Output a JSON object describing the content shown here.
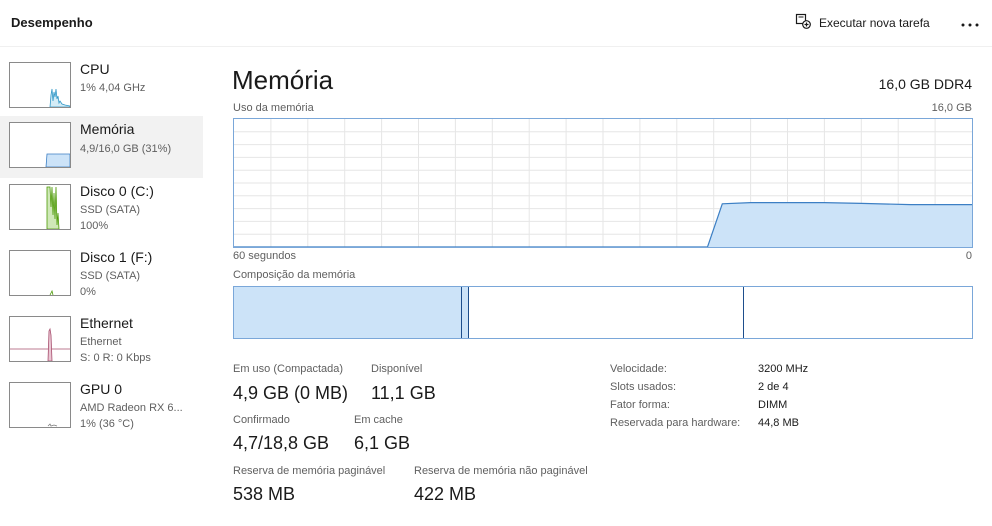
{
  "header": {
    "title": "Desempenho",
    "run_task_label": "Executar nova tarefa",
    "run_task_icon": "new-task-icon",
    "more_icon": "more-options-icon"
  },
  "sidebar": {
    "items": [
      {
        "name": "CPU",
        "line1": "1%  4,04 GHz",
        "line2": "",
        "color": "#2f97c7",
        "active": false
      },
      {
        "name": "Memória",
        "line1": "4,9/16,0 GB (31%)",
        "line2": "",
        "color": "#2f7ed8",
        "active": true
      },
      {
        "name": "Disco 0 (C:)",
        "line1": "SSD (SATA)",
        "line2": "100%",
        "color": "#4d9a06",
        "active": false
      },
      {
        "name": "Disco 1 (F:)",
        "line1": "SSD (SATA)",
        "line2": "0%",
        "color": "#4d9a06",
        "active": false
      },
      {
        "name": "Ethernet",
        "line1": "Ethernet",
        "line2": "S: 0 R: 0 Kbps",
        "color": "#a74f6e",
        "active": false
      },
      {
        "name": "GPU 0",
        "line1": "AMD Radeon RX 6...",
        "line2": "1%  (36 °C)",
        "color": "#7a7a7a",
        "active": false
      }
    ]
  },
  "main": {
    "title": "Memória",
    "spec": "16,0 GB DDR4",
    "usage_label": "Uso da memória",
    "usage_max": "16,0 GB",
    "time_left": "60 segundos",
    "time_right": "0",
    "composition_label": "Composição da memória"
  },
  "usage_graph": {
    "time_window_seconds": 60,
    "max_gb": 16.0,
    "fill_color": "#cce3f8",
    "line_color": "#3c7fc4",
    "grid_color": "#e6e6e6",
    "points": [
      {
        "t": 60,
        "gb": 0
      },
      {
        "t": 21.5,
        "gb": 0
      },
      {
        "t": 20.3,
        "gb": 5.4
      },
      {
        "t": 18,
        "gb": 5.55
      },
      {
        "t": 12,
        "gb": 5.55
      },
      {
        "t": 9,
        "gb": 5.45
      },
      {
        "t": 5,
        "gb": 5.3
      },
      {
        "t": 0,
        "gb": 5.3
      }
    ]
  },
  "composition": {
    "in_use_fraction": 0.309,
    "modified_fraction": 0.009,
    "standby_fraction": 0.373,
    "free_fraction": 0.309,
    "in_use_color": "#cce3f8",
    "border_color": "#1e4e8c"
  },
  "stats": {
    "in_use_label": "Em uso (Compactada)",
    "in_use_value": "4,9 GB (0 MB)",
    "available_label": "Disponível",
    "available_value": "11,1 GB",
    "committed_label": "Confirmado",
    "committed_value": "4,7/18,8 GB",
    "cached_label": "Em cache",
    "cached_value": "6,1 GB",
    "paged_label": "Reserva de memória paginável",
    "paged_value": "538 MB",
    "nonpaged_label": "Reserva de memória não paginável",
    "nonpaged_value": "422 MB"
  },
  "details": {
    "speed_label": "Velocidade:",
    "speed_value": "3200 MHz",
    "slots_label": "Slots usados:",
    "slots_value": "2 de 4",
    "form_label": "Fator forma:",
    "form_value": "DIMM",
    "reserved_label": "Reservada para hardware:",
    "reserved_value": "44,8 MB"
  }
}
